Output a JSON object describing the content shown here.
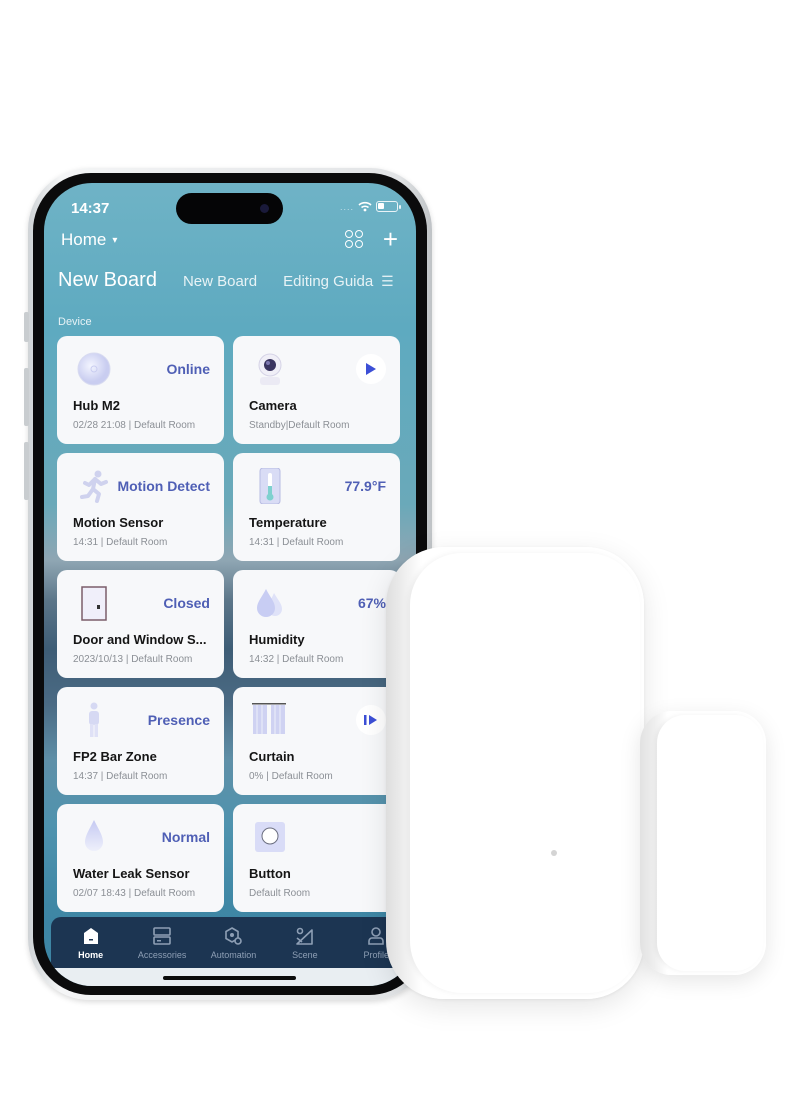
{
  "status_bar": {
    "time": "14:37",
    "signal": "....",
    "wifi_icon": "wifi-icon",
    "battery_icon": "battery-icon"
  },
  "header": {
    "home_selector": "Home",
    "home_caret": "▾",
    "layout_icon": "grid-icon",
    "add_icon": "+"
  },
  "board_tabs": {
    "active": "New Board",
    "items": [
      "New Board",
      "Editing Guida"
    ],
    "menu_icon": "☰"
  },
  "section_label": "Device",
  "devices": [
    {
      "name": "Hub M2",
      "status": "Online",
      "sub": "02/28 21:08 | Default Room",
      "icon": "hub-icon"
    },
    {
      "name": "Camera",
      "status": "",
      "sub": "Standby|Default Room",
      "icon": "camera-icon",
      "action_icon": "play-icon"
    },
    {
      "name": "Motion Sensor",
      "status": "Motion Detect",
      "sub": "14:31 | Default Room",
      "icon": "running-person-icon"
    },
    {
      "name": "Temperature",
      "status": "77.9°F",
      "sub": "14:31 | Default Room",
      "icon": "thermometer-icon"
    },
    {
      "name": "Door and Window S...",
      "status": "Closed",
      "sub": "2023/10/13 | Default Room",
      "icon": "door-icon"
    },
    {
      "name": "Humidity",
      "status": "67%",
      "sub": "14:32 | Default Room",
      "icon": "water-drops-icon"
    },
    {
      "name": "FP2 Bar Zone",
      "status": "Presence",
      "sub": "14:37 | Default Room",
      "icon": "person-icon"
    },
    {
      "name": "Curtain",
      "status": "",
      "sub": "0% | Default Room",
      "icon": "curtain-icon",
      "action_icon": "pause-play-icon"
    },
    {
      "name": "Water Leak Sensor",
      "status": "Normal",
      "sub": "02/07 18:43 | Default Room",
      "icon": "water-drop-icon"
    },
    {
      "name": "Button",
      "status": "",
      "sub": "Default Room",
      "icon": "button-icon"
    }
  ],
  "bottom_nav": {
    "active": "Home",
    "items": [
      {
        "label": "Home",
        "icon": "home-icon"
      },
      {
        "label": "Accessories",
        "icon": "accessories-icon"
      },
      {
        "label": "Automation",
        "icon": "automation-icon"
      },
      {
        "label": "Scene",
        "icon": "scene-icon"
      },
      {
        "label": "Profile",
        "icon": "profile-icon"
      }
    ]
  },
  "colors": {
    "accent": "#4f5fb5",
    "nav_background": "#1c3552",
    "screen_top": "#6fb3c6",
    "card_background": "#f7f8fa"
  }
}
